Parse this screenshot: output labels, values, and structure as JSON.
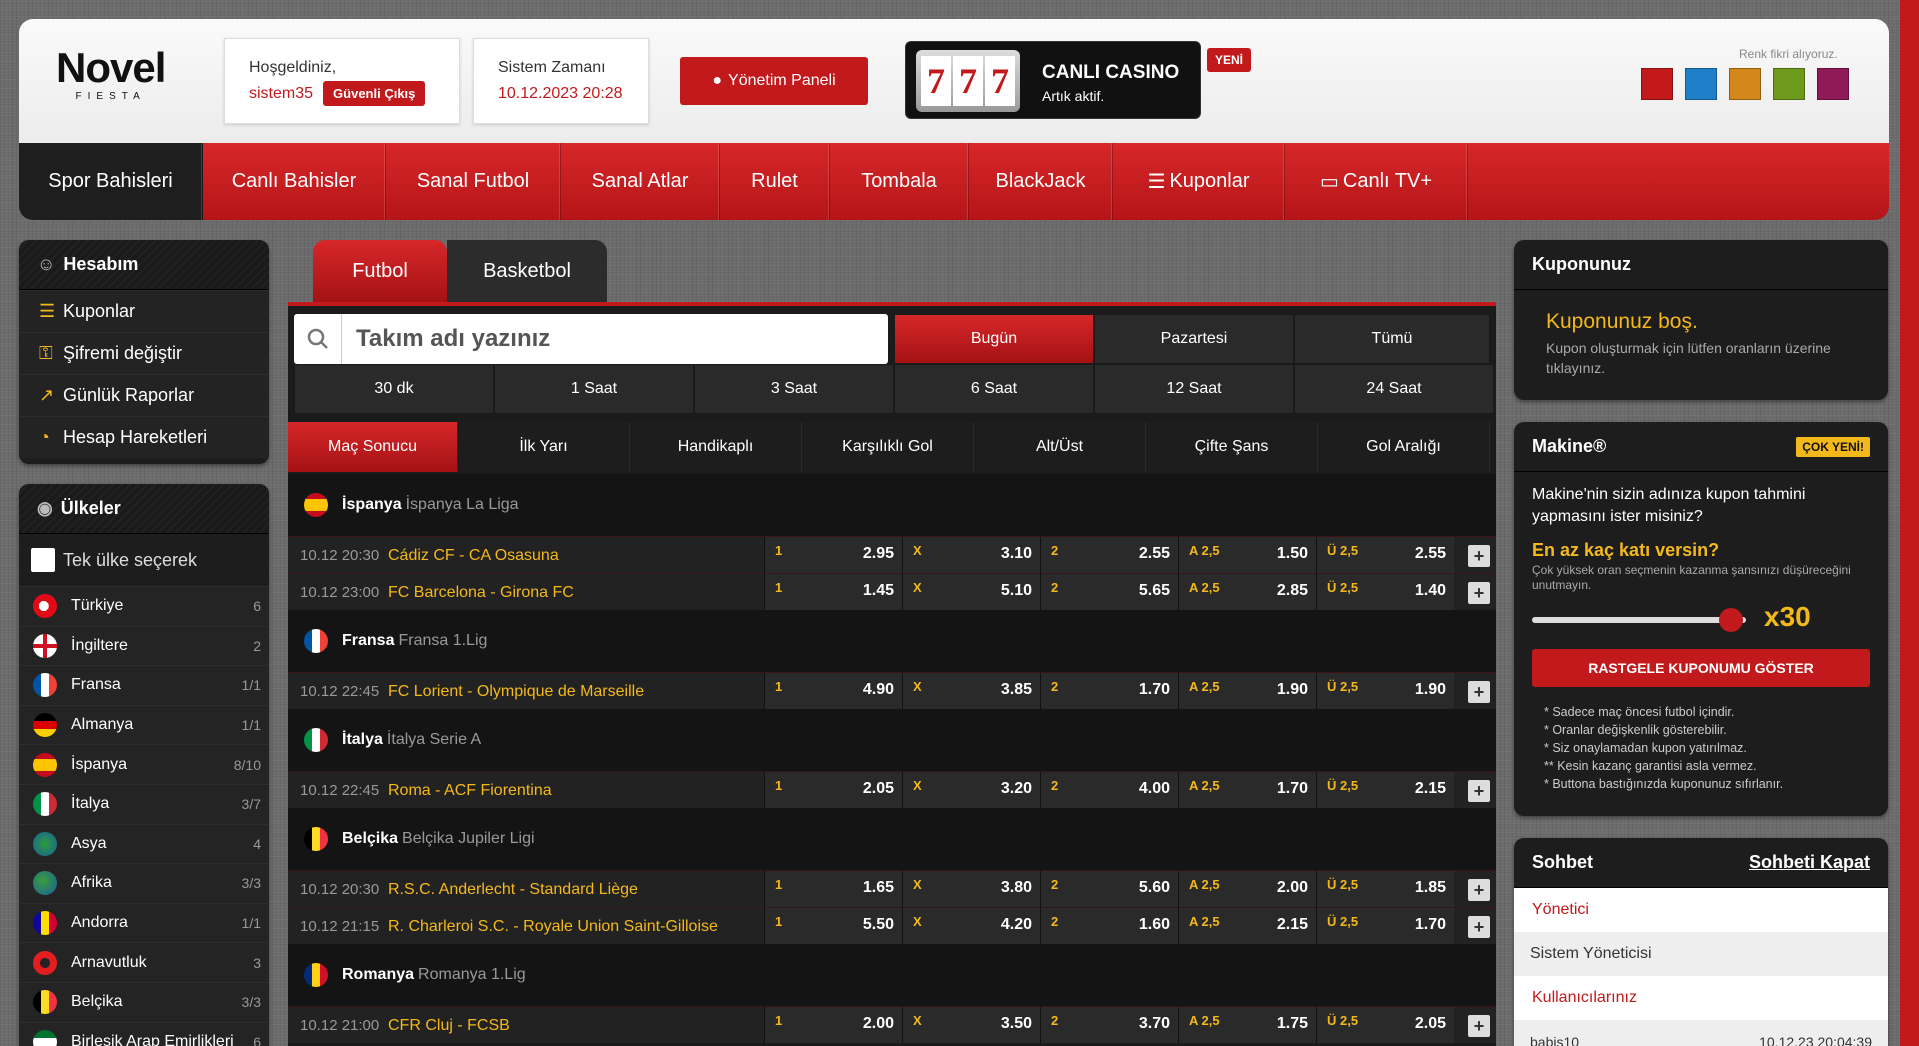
{
  "header": {
    "logo_main": "Novel",
    "logo_sub": "FIESTA",
    "welcome_label": "Hoşgeldiniz,",
    "username": "sistem35",
    "logout_label": "Güvenli Çıkış",
    "time_label": "Sistem Zamanı",
    "time_value": "10.12.2023 20:28",
    "admin_label": "Yönetim Paneli",
    "casino_title": "CANLI CASINO",
    "casino_sub": "Artık aktif.",
    "casino_badge": "YENİ",
    "color_label": "Renk fikri alıyoruz.",
    "swatches": [
      "#c2191c",
      "#1f7fc8",
      "#d4871a",
      "#6e9a1c",
      "#8e1a5a"
    ]
  },
  "nav": [
    "Spor Bahisleri",
    "Canlı Bahisler",
    "Sanal Futbol",
    "Sanal Atlar",
    "Rulet",
    "Tombala",
    "BlackJack",
    "Kuponlar",
    "Canlı TV+"
  ],
  "account": {
    "title": "Hesabım",
    "items": [
      "Kuponlar",
      "Şifremi değiştir",
      "Günlük Raporlar",
      "Hesap Hareketleri"
    ]
  },
  "countries": {
    "title": "Ülkeler",
    "single_label": "Tek ülke seçerek",
    "items": [
      {
        "name": "Türkiye",
        "count": "6"
      },
      {
        "name": "İngiltere",
        "count": "2"
      },
      {
        "name": "Fransa",
        "count": "1/1"
      },
      {
        "name": "Almanya",
        "count": "1/1"
      },
      {
        "name": "İspanya",
        "count": "8/10"
      },
      {
        "name": "İtalya",
        "count": "3/7"
      },
      {
        "name": "Asya",
        "count": "4"
      },
      {
        "name": "Afrika",
        "count": "3/3"
      },
      {
        "name": "Andorra",
        "count": "1/1"
      },
      {
        "name": "Arnavutluk",
        "count": "3"
      },
      {
        "name": "Belçika",
        "count": "3/3"
      },
      {
        "name": "Birleşik Arap Emirlikleri",
        "count": "6"
      }
    ]
  },
  "sport_tabs": [
    "Futbol",
    "Basketbol"
  ],
  "search": {
    "placeholder": "Takım adı yazınız"
  },
  "day_filters": [
    "Bugün",
    "Pazartesi",
    "Tümü"
  ],
  "hour_filters": [
    "30 dk",
    "1 Saat",
    "3 Saat",
    "6 Saat",
    "12 Saat",
    "24 Saat"
  ],
  "markets": [
    "Maç Sonucu",
    "İlk Yarı",
    "Handikaplı",
    "Karşılıklı Gol",
    "Alt/Üst",
    "Çifte Şans",
    "Gol Aralığı"
  ],
  "odd_keys": [
    "1",
    "X",
    "2",
    "A 2,5",
    "Ü 2,5"
  ],
  "leagues": [
    {
      "country": "İspanya",
      "league": "İspanya La Liga",
      "matches": [
        {
          "time": "10.12 20:30",
          "teams": "Cádiz CF - CA Osasuna",
          "odds": [
            "2.95",
            "3.10",
            "2.55",
            "1.50",
            "2.55"
          ]
        },
        {
          "time": "10.12 23:00",
          "teams": "FC Barcelona - Girona FC",
          "odds": [
            "1.45",
            "5.10",
            "5.65",
            "2.85",
            "1.40"
          ]
        }
      ]
    },
    {
      "country": "Fransa",
      "league": "Fransa 1.Lig",
      "matches": [
        {
          "time": "10.12 22:45",
          "teams": "FC Lorient - Olympique de Marseille",
          "odds": [
            "4.90",
            "3.85",
            "1.70",
            "1.90",
            "1.90"
          ]
        }
      ]
    },
    {
      "country": "İtalya",
      "league": "İtalya Serie A",
      "matches": [
        {
          "time": "10.12 22:45",
          "teams": "Roma - ACF Fiorentina",
          "odds": [
            "2.05",
            "3.20",
            "4.00",
            "1.70",
            "2.15"
          ]
        }
      ]
    },
    {
      "country": "Belçika",
      "league": "Belçika Jupiler Ligi",
      "matches": [
        {
          "time": "10.12 20:30",
          "teams": "R.S.C. Anderlecht - Standard Liège",
          "odds": [
            "1.65",
            "3.80",
            "5.60",
            "2.00",
            "1.85"
          ]
        },
        {
          "time": "10.12 21:15",
          "teams": "R. Charleroi S.C. - Royale Union Saint-Gilloise",
          "odds": [
            "5.50",
            "4.20",
            "1.60",
            "2.15",
            "1.70"
          ]
        }
      ]
    },
    {
      "country": "Romanya",
      "league": "Romanya 1.Lig",
      "matches": [
        {
          "time": "10.12 21:00",
          "teams": "CFR Cluj - FCSB",
          "odds": [
            "2.00",
            "3.50",
            "3.70",
            "1.75",
            "2.05"
          ]
        }
      ]
    }
  ],
  "coupon": {
    "title": "Kuponunuz",
    "empty": "Kuponunuz boş.",
    "hint": "Kupon oluşturmak için lütfen oranların üzerine tıklayınız."
  },
  "machine": {
    "title": "Makine®",
    "badge": "ÇOK YENİ!",
    "desc": "Makine'nin sizin adınıza kupon tahmini yapmasını ister misiniz?",
    "q": "En az kaç katı versin?",
    "qsub": "Çok yüksek oran seçmenin kazanma şansınızı düşüreceğini unutmayın.",
    "value": "x30",
    "slider_fraction": 0.93,
    "btn": "RASTGELE KUPONUMU GÖSTER",
    "notes": [
      "* Sadece maç öncesi futbol içindir.",
      "* Oranlar değişkenlik gösterebilir.",
      "* Siz onaylamadan kupon yatırılmaz.",
      "** Kesin kazanç garantisi asla vermez.",
      "* Buttona bastığınızda kuponunuz sıfırlanır."
    ]
  },
  "chat": {
    "title": "Sohbet",
    "close": "Sohbeti Kapat",
    "admin_head": "Yönetici",
    "admin_name": "Sistem Yöneticisi",
    "users_head": "Kullanıcılarınız",
    "user": "babis10",
    "user_time": "10.12.23 20:04:39"
  }
}
